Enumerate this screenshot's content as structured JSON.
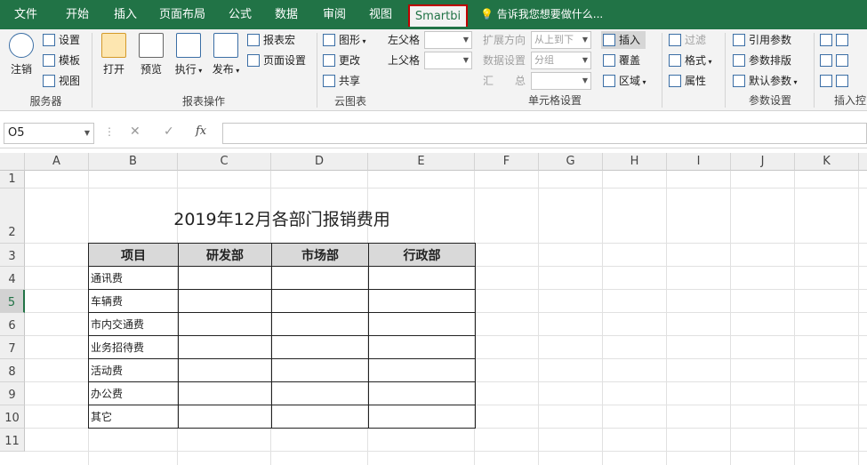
{
  "tabs": [
    "文件",
    "开始",
    "插入",
    "页面布局",
    "公式",
    "数据",
    "审阅",
    "视图",
    "Smartbi"
  ],
  "tell_me": "告诉我您想要做什么...",
  "ribbon": {
    "server": {
      "logout": "注销",
      "settings": "设置",
      "template": "模板",
      "view": "视图",
      "label": "服务器"
    },
    "report_ops": {
      "open": "打开",
      "preview": "预览",
      "execute": "执行",
      "publish": "发布",
      "report_macro": "报表宏",
      "page_setup": "页面设置",
      "label": "报表操作"
    },
    "cloud": {
      "figure": "图形",
      "update": "更改",
      "share": "共享",
      "label": "云图表"
    },
    "parent": {
      "left_parent": "左父格",
      "top_parent": "上父格"
    },
    "cell_settings": {
      "expand_dir": "扩展方向",
      "expand_dir_value": "从上到下",
      "data_settings": "数据设置",
      "data_settings_value": "分组",
      "summary": "汇　　总",
      "insert": "插入",
      "cover": "覆盖",
      "area": "区域",
      "label": "单元格设置"
    },
    "filter": {
      "filter": "过滤",
      "format": "格式",
      "attr": "属性"
    },
    "params": {
      "ref_param": "引用参数",
      "param_layout": "参数排版",
      "default_param": "默认参数",
      "label": "参数设置"
    },
    "insert_ctrl": {
      "label": "插入控"
    }
  },
  "formula_bar": {
    "name_box": "O5",
    "fx": "fx"
  },
  "columns": [
    "A",
    "B",
    "C",
    "D",
    "E",
    "F",
    "G",
    "H",
    "I",
    "J",
    "K"
  ],
  "rows": [
    "1",
    "2",
    "3",
    "4",
    "5",
    "6",
    "7",
    "8",
    "9",
    "10",
    "11"
  ],
  "sheet": {
    "title": "2019年12月各部门报销费用",
    "headers": [
      "项目",
      "研发部",
      "市场部",
      "行政部"
    ],
    "items": [
      "通讯费",
      "车辆费",
      "市内交通费",
      "业务招待费",
      "活动费",
      "办公费",
      "其它"
    ]
  }
}
